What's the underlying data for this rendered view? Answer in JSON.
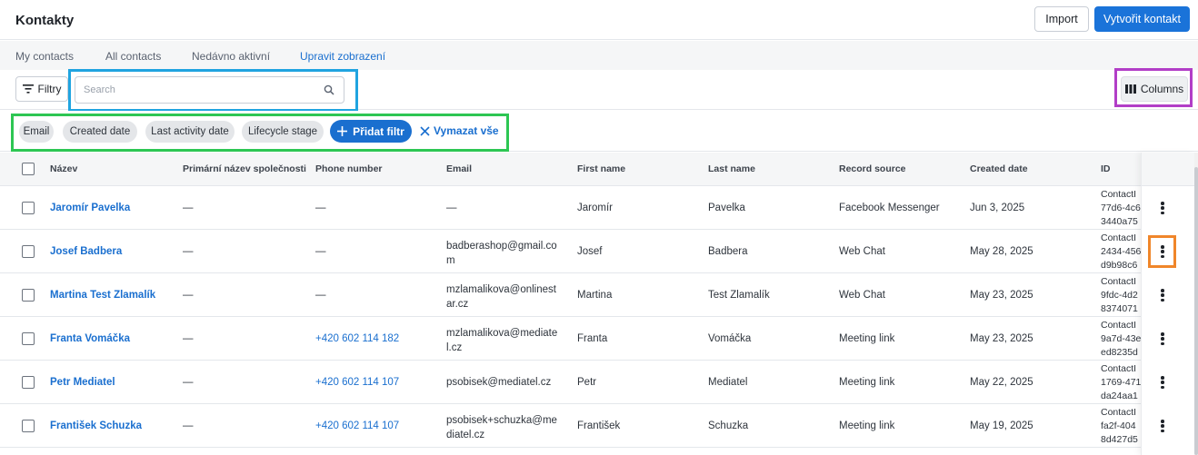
{
  "header": {
    "title": "Kontakty",
    "import_label": "Import",
    "create_label": "Vytvořit kontakt"
  },
  "tabs": [
    {
      "label": "My contacts"
    },
    {
      "label": "All contacts"
    },
    {
      "label": "Nedávno aktivní"
    },
    {
      "label": "Upravit zobrazení"
    }
  ],
  "toolbar": {
    "filter_label": "Filtry",
    "search_placeholder": "Search",
    "columns_label": "Columns"
  },
  "filters": {
    "chips": [
      "Email",
      "Created date",
      "Last activity date",
      "Lifecycle stage"
    ],
    "add_label": "Přidat filtr",
    "clear_label": "Vymazat vše"
  },
  "table": {
    "columns": [
      "Název",
      "Primární název společnosti",
      "Phone number",
      "Email",
      "First name",
      "Last name",
      "Record source",
      "Created date",
      "ID"
    ],
    "rows": [
      {
        "name": "Jaromír Pavelka",
        "company": "—",
        "phone": "—",
        "email_l1": "—",
        "email_l2": "",
        "first": "Jaromír",
        "last": "Pavelka",
        "source": "Facebook Messenger",
        "created": "Jun 3, 2025",
        "id": "ContactI\n77d6-4c6\n3440a75"
      },
      {
        "name": "Josef Badbera",
        "company": "—",
        "phone": "—",
        "email_l1": "badberashop@gmail.co",
        "email_l2": "m",
        "first": "Josef",
        "last": "Badbera",
        "source": "Web Chat",
        "created": "May 28, 2025",
        "id": "ContactI\n2434-456\nd9b98c6"
      },
      {
        "name": "Martina Test Zlamalík",
        "company": "—",
        "phone": "—",
        "email_l1": "mzlamalikova@onlinest",
        "email_l2": "ar.cz",
        "first": "Martina",
        "last": "Test Zlamalík",
        "source": "Web Chat",
        "created": "May 23, 2025",
        "id": "ContactI\n9fdc-4d2\n8374071"
      },
      {
        "name": "Franta Vomáčka",
        "company": "—",
        "phone": "+420 602 114 182",
        "email_l1": "mzlamalikova@mediate",
        "email_l2": "l.cz",
        "first": "Franta",
        "last": "Vomáčka",
        "source": "Meeting link",
        "created": "May 23, 2025",
        "id": "ContactI\n9a7d-43e\ned8235d"
      },
      {
        "name": "Petr Mediatel",
        "company": "—",
        "phone": "+420 602 114 107",
        "email_l1": "psobisek@mediatel.cz",
        "email_l2": "",
        "first": "Petr",
        "last": "Mediatel",
        "source": "Meeting link",
        "created": "May 22, 2025",
        "id": "ContactI\n1769-471\nda24aa1"
      },
      {
        "name": "František Schuzka",
        "company": "—",
        "phone": "+420 602 114 107",
        "email_l1": "psobisek+schuzka@me",
        "email_l2": "diatel.cz",
        "first": "František",
        "last": "Schuzka",
        "source": "Meeting link",
        "created": "May 19, 2025",
        "id": "ContactI\nfa2f-404\n8d427d5"
      }
    ]
  },
  "colors": {
    "accent": "#1a73d9",
    "link": "#1a6fcf",
    "highlight_search": "#20a4e0",
    "highlight_filters": "#2dc653",
    "highlight_columns": "#b23ec7",
    "highlight_kebab": "#f0862a"
  }
}
